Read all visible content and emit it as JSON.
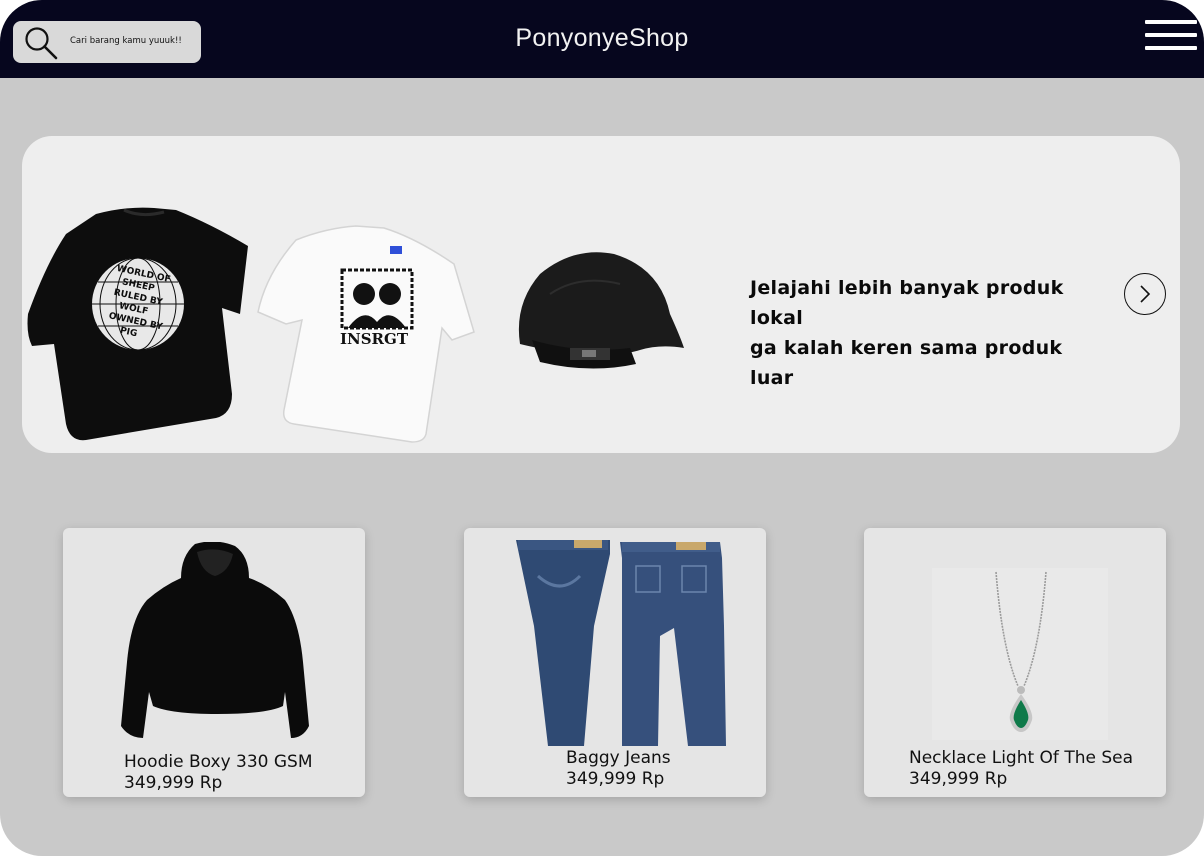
{
  "header": {
    "brand": "PonyonyeShop",
    "search": {
      "placeholder": "Cari barang kamu yuuuk!!",
      "icon": "search-icon"
    },
    "menu_icon": "hamburger-menu-icon"
  },
  "hero": {
    "line1": "Jelajahi lebih banyak produk lokal",
    "line2": "ga kalah keren sama produk luar",
    "tshirt_black_print": [
      "WORLD OF",
      "SHEEP",
      "RULED BY",
      "WOLF",
      "OWNED BY",
      "PIG"
    ],
    "tshirt_white_print": "INSRGT",
    "next_icon": "chevron-right-icon"
  },
  "products": [
    {
      "name": "Hoodie Boxy 330 GSM",
      "price": "349,999 Rp"
    },
    {
      "name": "Baggy Jeans",
      "price": "349,999 Rp"
    },
    {
      "name": "Necklace Light Of The Sea",
      "price": "349,999 Rp"
    }
  ],
  "colors": {
    "header_bg": "#06061e",
    "page_bg": "#c9c9c9",
    "hero_bg": "#eeeeee",
    "card_bg": "#e5e5e5"
  }
}
